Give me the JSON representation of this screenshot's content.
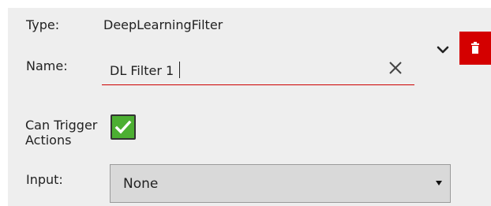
{
  "filter": {
    "type_label": "Type:",
    "type_value": "DeepLearningFilter",
    "name_label": "Name:",
    "name_value": "DL Filter 1",
    "can_trigger_label_line1": "Can Trigger",
    "can_trigger_label_line2": "Actions",
    "can_trigger_checked": true,
    "input_label": "Input:",
    "input_selected": "None"
  },
  "icons": {
    "clear": "close-icon",
    "expand": "chevron-down-icon",
    "delete": "trash-icon",
    "check": "checkmark-icon",
    "dropdown": "caret-down-icon"
  },
  "colors": {
    "panel_background": "#eeeeee",
    "delete_button": "#d40000",
    "checkbox_fill": "#4caf32",
    "field_underline": "#cc0000",
    "select_background": "#d9d9d9"
  }
}
